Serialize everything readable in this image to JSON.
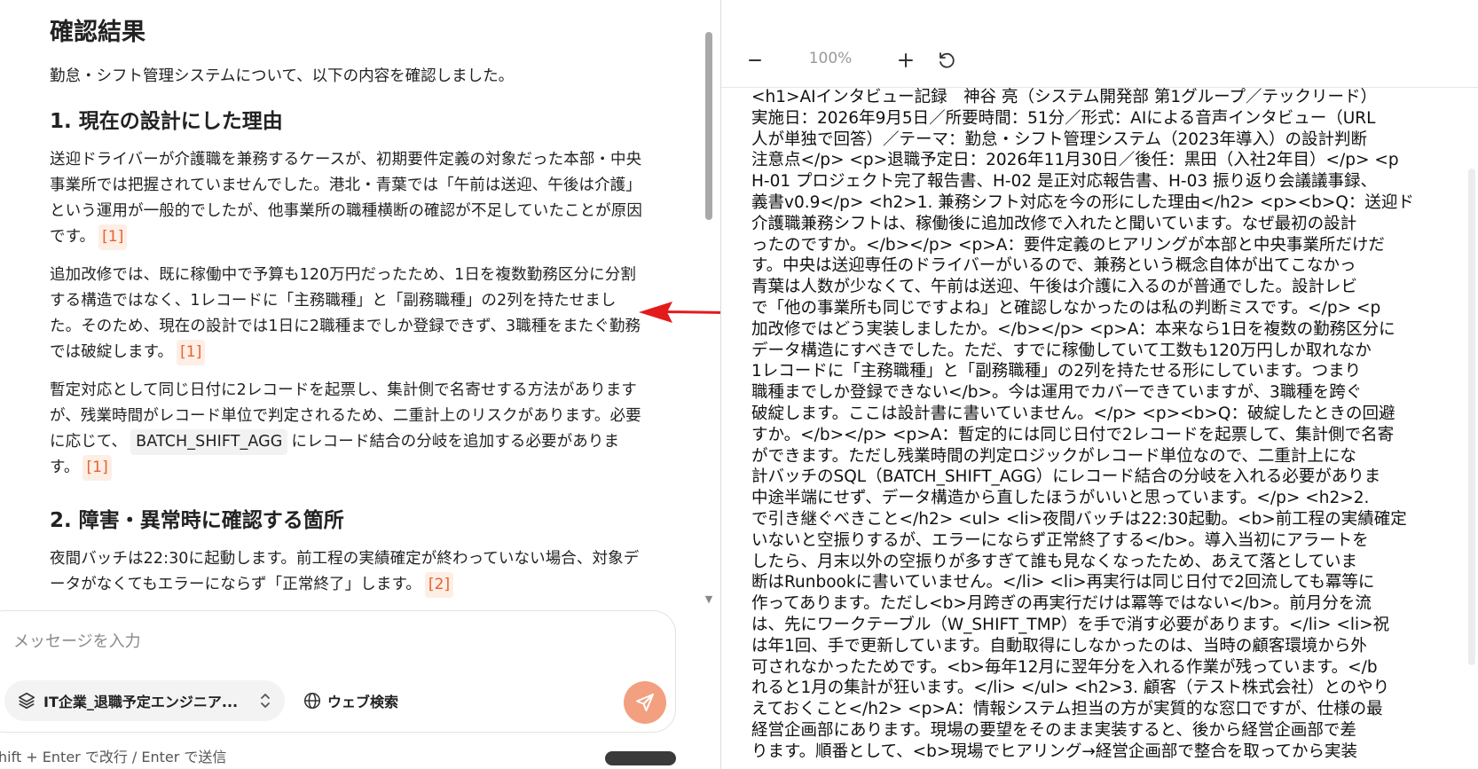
{
  "chat": {
    "title": "確認結果",
    "intro": "勤怠・シフト管理システムについて、以下の内容を確認しました。",
    "sections": [
      {
        "heading": "1. 現在の設計にした理由",
        "p1": "送迎ドライバーが介護職を兼務するケースが、初期要件定義の対象だった本部・中央事業所では把握されていませんでした。港北・青葉では「午前は送迎、午後は介護」という運用が一般的でしたが、他事業所の職種横断の確認が不足していたことが原因です。",
        "p1_cite": "[1]",
        "p2": "追加改修では、既に稼働中で予算も120万円だったため、1日を複数勤務区分に分割する構造ではなく、1レコードに「主務職種」と「副務職種」の2列を持たせました。そのため、現在の設計では1日に2職種までしか登録できず、3職種をまたぐ勤務では破綻します。",
        "p2_cite": "[1]",
        "p3_before": "暫定対応として同じ日付に2レコードを起票し、集計側で名寄せする方法がありますが、残業時間がレコード単位で判定されるため、二重計上のリスクがあります。必要に応じて、",
        "p3_code": "BATCH_SHIFT_AGG",
        "p3_after": "にレコード結合の分岐を追加する必要があります。",
        "p3_cite": "[1]"
      },
      {
        "heading": "2. 障害・異常時に確認する箇所",
        "p1": "夜間バッチは22:30に起動します。前工程の実績確定が終わっていない場合、対象データがなくてもエラーにならず「正常終了」します。",
        "p1_cite": "[2]"
      }
    ],
    "composer": {
      "placeholder": "メッセージを入力",
      "knowledge_base": "IT企業_退職予定エンジニア...",
      "web_search": "ウェブ検索",
      "hint": "hift + Enter で改行 / Enter で送信"
    }
  },
  "viewer": {
    "zoom": "100%",
    "lines": [
      "<h1>AIインタビュー記録　神谷 亮（システム開発部 第1グループ／テックリード）",
      "実施日：2026年9月5日／所要時間：51分／形式：AIによる音声インタビュー（URL",
      "人が単独で回答）／テーマ：勤怠・シフト管理システム（2023年導入）の設計判断",
      "注意点</p> <p>退職予定日：2026年11月30日／後任：黒田（入社2年目）</p> <p",
      "H-01 プロジェクト完了報告書、H-02 是正対応報告書、H-03 振り返り会議議事録、",
      "義書v0.9</p> <h2>1. 兼務シフト対応を今の形にした理由</h2> <p><b>Q：送迎ド",
      "介護職兼務シフトは、稼働後に追加改修で入れたと聞いています。なぜ最初の設計",
      "ったのですか。</b></p> <p>A：要件定義のヒアリングが本部と中央事業所だけだ",
      "す。中央は送迎専任のドライバーがいるので、兼務という概念自体が出てこなかっ",
      "青葉は人数が少なくて、午前は送迎、午後は介護に入るのが普通でした。設計レビ",
      "で「他の事業所も同じですよね」と確認しなかったのは私の判断ミスです。</p> <p",
      "加改修ではどう実装しましたか。</b></p> <p>A：本来なら1日を複数の勤務区分に",
      "データ構造にすべきでした。ただ、すでに稼働していて工数も120万円しか取れなか",
      "1レコードに「主務職種」と「副務職種」の2列を持たせる形にしています。つまり",
      "職種までしか登録できない</b>。今は運用でカバーできていますが、3職種を跨ぐ",
      "破綻します。ここは設計書に書いていません。</p> <p><b>Q：破綻したときの回避",
      "すか。</b></p> <p>A：暫定的には同じ日付で2レコードを起票して、集計側で名寄",
      "ができます。ただし残業時間の判定ロジックがレコード単位なので、二重計上にな",
      "計バッチのSQL（BATCH_SHIFT_AGG）にレコード結合の分岐を入れる必要がありま",
      "中途半端にせず、データ構造から直したほうがいいと思っています。</p> <h2>2. ",
      "で引き継ぐべきこと</h2> <ul> <li>夜間バッチは22:30起動。<b>前工程の実績確定",
      "いないと空振りするが、エラーにならず正常終了する</b>。導入当初にアラートを",
      "したら、月末以外の空振りが多すぎて誰も見なくなったため、あえて落としていま",
      "断はRunbookに書いていません。</li> <li>再実行は同じ日付で2回流しても冪等に",
      "作ってあります。ただし<b>月跨ぎの再実行だけは冪等ではない</b>。前月分を流",
      "は、先にワークテーブル（W_SHIFT_TMP）を手で消す必要があります。</li> <li>祝",
      "は年1回、手で更新しています。自動取得にしなかったのは、当時の顧客環境から外",
      "可されなかったためです。<b>毎年12月に翌年分を入れる作業が残っています。</b",
      "れると1月の集計が狂います。</li> </ul> <h2>3. 顧客（テスト株式会社）とのやり",
      "えておくこと</h2> <p>A：情報システム担当の方が実質的な窓口ですが、仕様の最",
      "経営企画部にあります。現場の要望をそのまま実装すると、後から経営企画部で差",
      "ります。順番として、<b>現場でヒアリング→経営企画部で整合を取ってから実装"
    ]
  },
  "colors": {
    "accent": "#e8622c",
    "send_button": "#f2a07f",
    "arrow": "#e31b1b"
  }
}
